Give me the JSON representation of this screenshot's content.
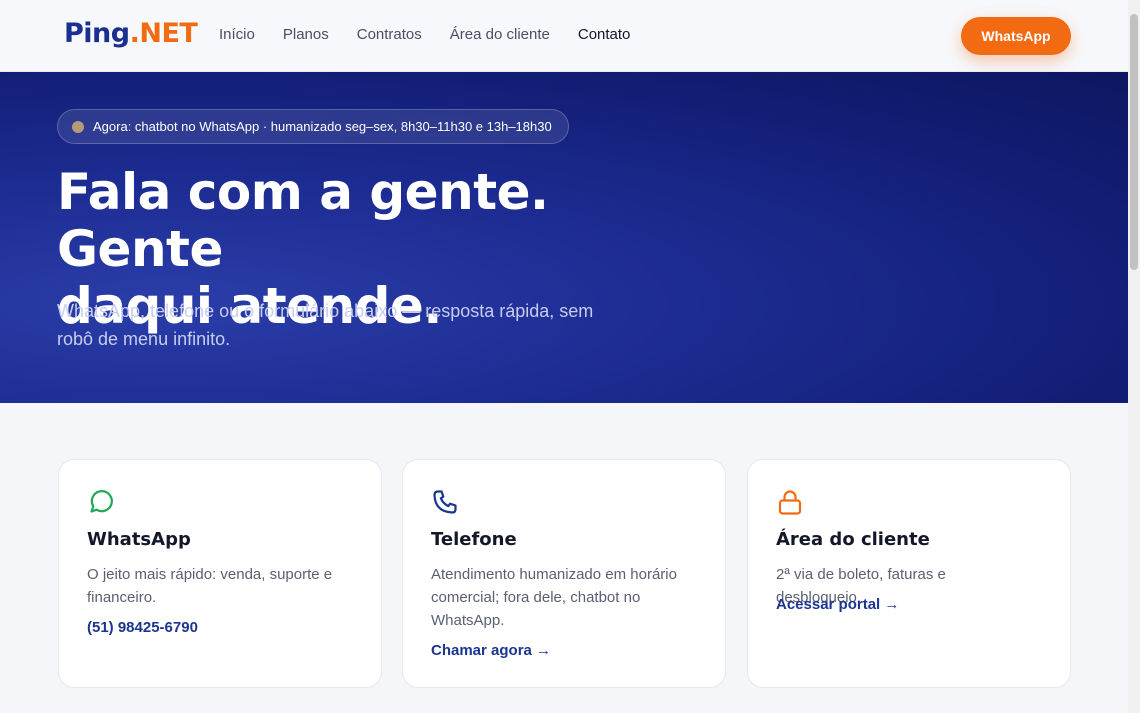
{
  "header": {
    "logo": {
      "ping": "Ping",
      "dot": ".",
      "net": "NET"
    },
    "nav": [
      "Início",
      "Planos",
      "Contratos",
      "Área do cliente",
      "Contato"
    ],
    "cta": "WhatsApp"
  },
  "hero": {
    "status": "Agora: chatbot no WhatsApp · humanizado seg–sex, 8h30–11h30 e 13h–18h30",
    "title_line1": "Fala com a gente. Gente",
    "title_line2": "daqui atende.",
    "subtitle": "WhatsApp, telefone ou o formulário abaixo — resposta rápida, sem robô de menu infinito."
  },
  "cards": [
    {
      "title": "WhatsApp",
      "desc": "O jeito mais rápido: venda, suporte e financeiro.",
      "link": "(51) 98425-6790",
      "icon": "whatsapp-icon",
      "icon_color": "#1fa855"
    },
    {
      "title": "Telefone",
      "desc": "Atendimento humanizado em horário comercial; fora dele, chatbot no WhatsApp.",
      "link": "Chamar agora →",
      "icon": "phone-icon",
      "icon_color": "#1b3590"
    },
    {
      "title": "Área do cliente",
      "desc": "2ª via de boleto, faturas e desbloqueio.",
      "link": "Acessar portal →",
      "icon": "lock-icon",
      "icon_color": "#f26a12"
    }
  ],
  "colors": {
    "brand": "#1b2f8f",
    "accent": "#f26a12"
  }
}
